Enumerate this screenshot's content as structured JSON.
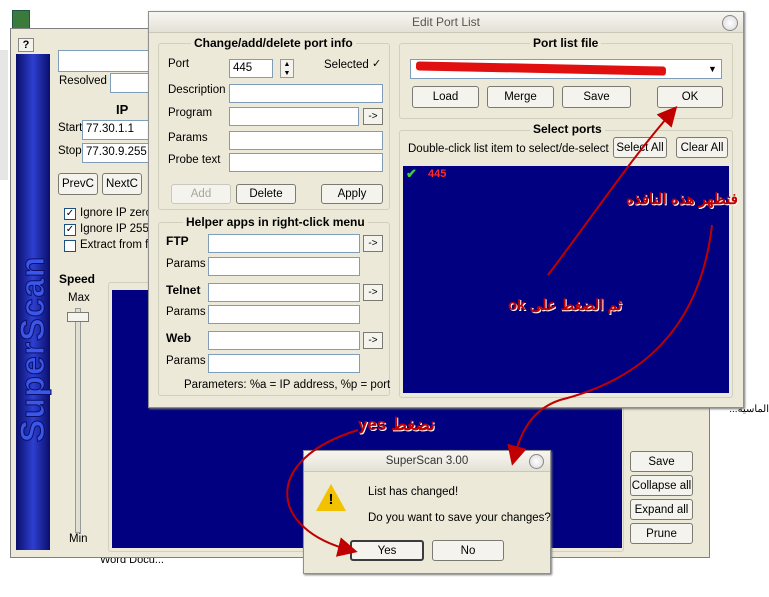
{
  "desktop": {
    "icons": [
      {
        "label": "Word Docu..."
      },
      {
        "label": "...الماسية"
      }
    ]
  },
  "superscan": {
    "help": "?",
    "resolved_label": "Resolved",
    "ip_header": "IP",
    "start_label": "Start",
    "start_value": "77.30.1.1",
    "stop_label": "Stop",
    "stop_value": "77.30.9.255",
    "prev_button": "PrevC",
    "next_button": "NextC",
    "ignore_zero": "Ignore IP zero",
    "ignore_255": "Ignore IP 255",
    "extract": "Extract from file",
    "speed": "Speed",
    "max": "Max",
    "min": "Min",
    "logo": "SuperScan",
    "side_buttons": [
      "Save",
      "Collapse all",
      "Expand all",
      "Prune"
    ]
  },
  "port_list": {
    "title": "Edit Port List",
    "change_group": "Change/add/delete port info",
    "port_label": "Port",
    "port_value": "445",
    "selected_label": "Selected",
    "description_label": "Description",
    "program_label": "Program",
    "params_label": "Params",
    "probe_label": "Probe text",
    "add_button": "Add",
    "delete_button": "Delete",
    "apply_button": "Apply",
    "helper_group": "Helper apps in right-click menu",
    "ftp_label": "FTP",
    "telnet_label": "Telnet",
    "web_label": "Web",
    "params_note": "Parameters: %a = IP address, %p = port",
    "file_group": "Port list file",
    "load_button": "Load",
    "merge_button": "Merge",
    "save_button": "Save",
    "ok_button": "OK",
    "select_group": "Select ports",
    "select_hint": "Double-click list item to select/de-select",
    "select_all": "Select All",
    "clear_all": "Clear All",
    "ports": [
      "445"
    ]
  },
  "dialog": {
    "title": "SuperScan 3.00",
    "message1": "List has changed!",
    "message2": "Do you want to save your changes?",
    "yes": "Yes",
    "no": "No"
  },
  "annotations": {
    "appear": "فتظهر هذه النافذه",
    "press_ok": "ثم الضغط على ok",
    "press_yes": "نضغط  yes"
  },
  "colors": {
    "list_bg": "#000080",
    "annotation": "#c00000",
    "logo": "#1f38b8"
  }
}
